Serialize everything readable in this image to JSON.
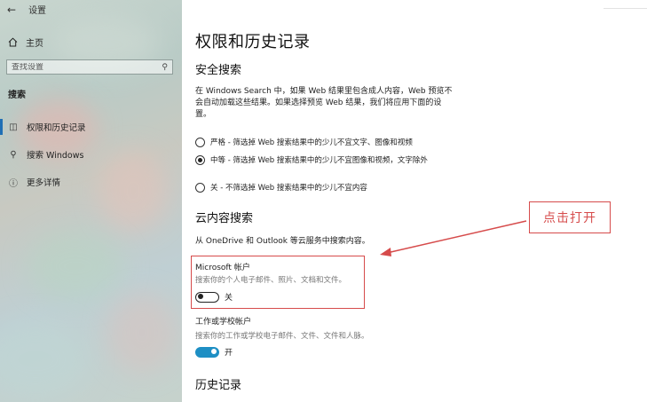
{
  "window": {
    "title": "设置"
  },
  "sidebar": {
    "home_label": "主页",
    "search_placeholder": "查找设置",
    "section_label": "搜索",
    "items": [
      {
        "label": "权限和历史记录",
        "icon": "permissions-icon",
        "active": true
      },
      {
        "label": "搜索 Windows",
        "icon": "search-icon",
        "active": false
      },
      {
        "label": "更多详情",
        "icon": "info-icon",
        "active": false
      }
    ]
  },
  "main": {
    "title": "权限和历史记录",
    "safe_search": {
      "heading": "安全搜索",
      "description": "在 Windows Search 中，如果 Web 结果里包含成人内容，Web 预览不会自动加载这些结果。如果选择预览 Web 结果，我们将应用下面的设置。",
      "options": [
        {
          "label": "严格 - 筛选掉 Web 搜索结果中的少儿不宜文字、图像和视频",
          "checked": false
        },
        {
          "label": "中等 - 筛选掉 Web 搜索结果中的少儿不宜图像和视频，文字除外",
          "checked": true
        },
        {
          "label": "关 - 不筛选掉 Web 搜索结果中的少儿不宜内容",
          "checked": false
        }
      ]
    },
    "cloud_search": {
      "heading": "云内容搜索",
      "description": "从 OneDrive 和 Outlook 等云服务中搜索内容。",
      "microsoft_account": {
        "title": "Microsoft 帐户",
        "subtitle": "搜索你的个人电子邮件、照片、文档和文件。",
        "toggle_state": "关",
        "on": false
      },
      "work_account": {
        "title": "工作或学校帐户",
        "subtitle": "搜索你的工作或学校电子邮件、文件、文件和人脉。",
        "toggle_state": "开",
        "on": true
      }
    },
    "history": {
      "heading": "历史记录"
    }
  },
  "annotation": {
    "label": "点击打开",
    "color": "#d64b4b"
  },
  "colors": {
    "accent": "#1f6fb5",
    "toggle_on": "#1e8fc4"
  }
}
